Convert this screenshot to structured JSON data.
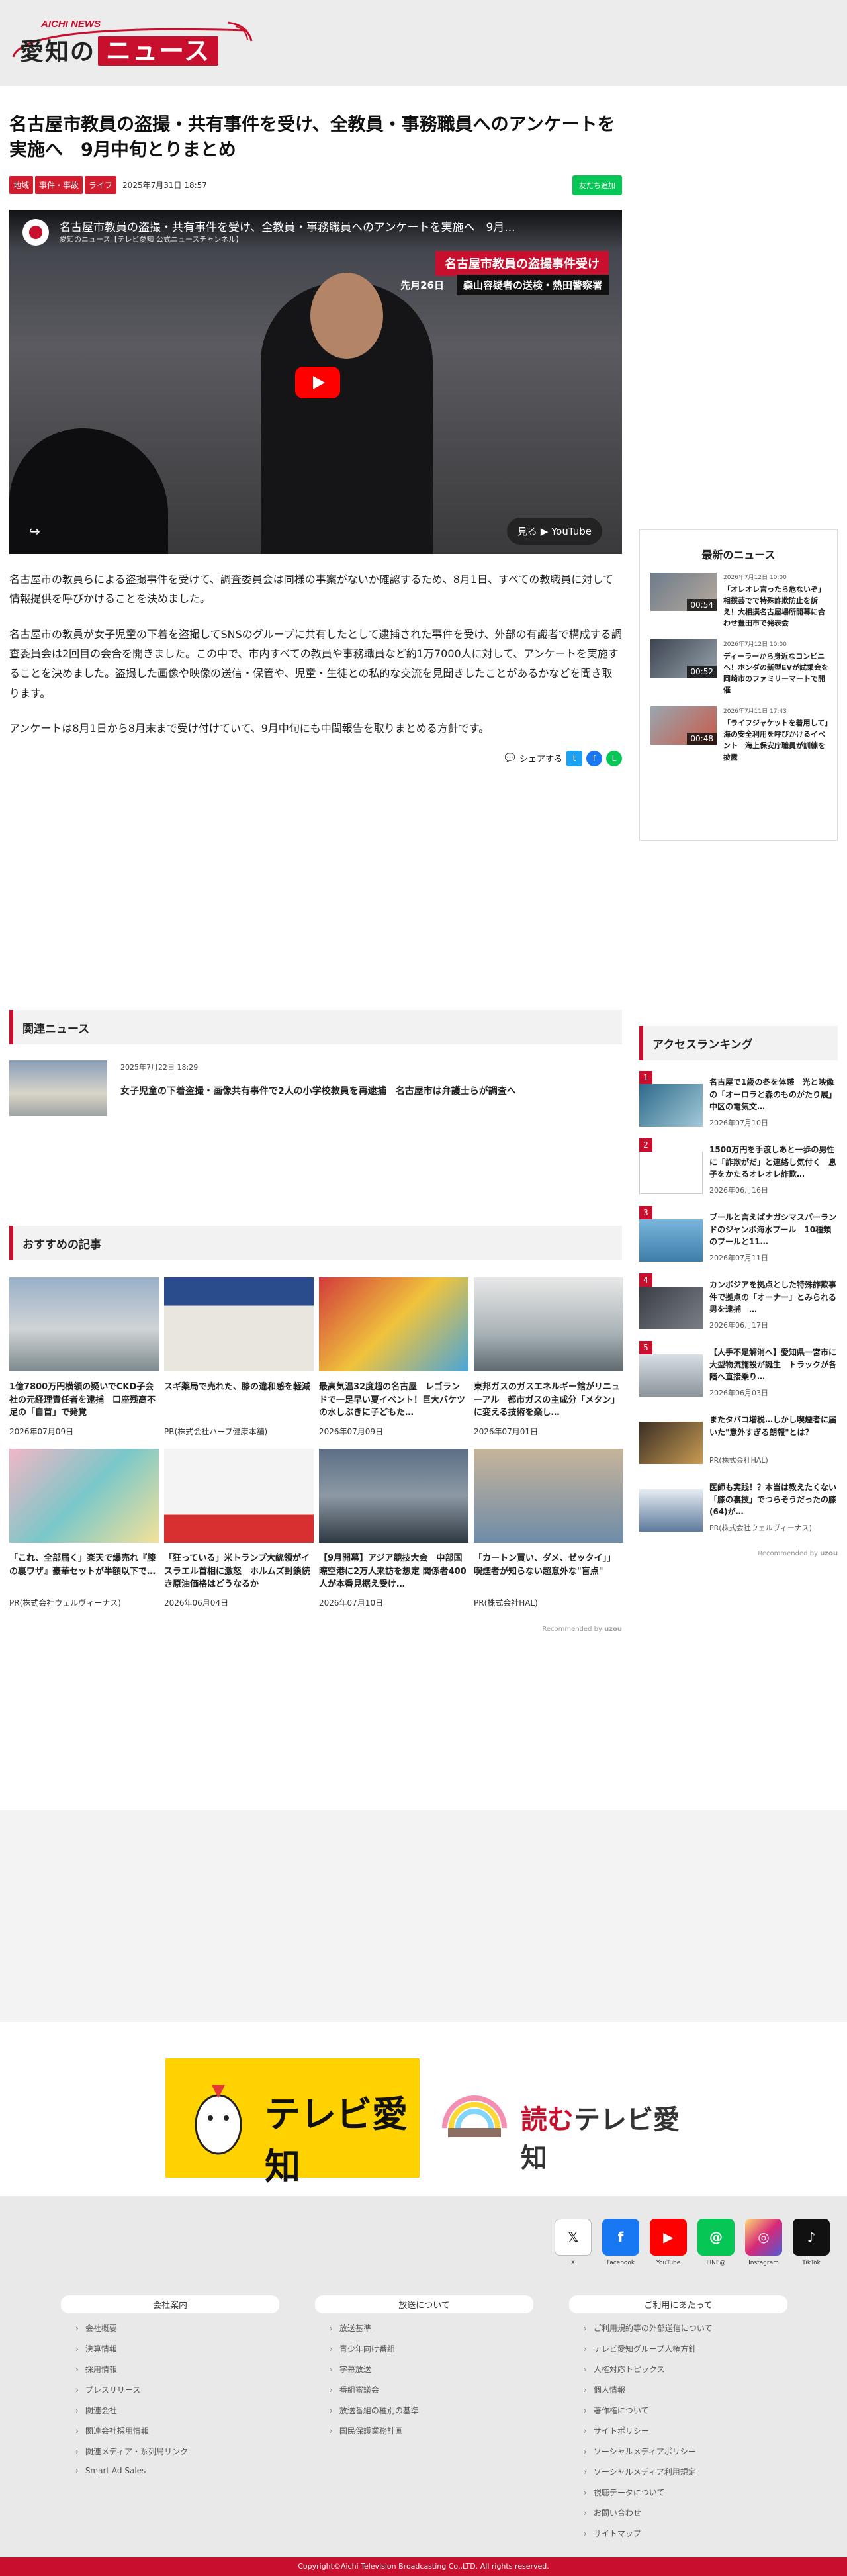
{
  "header": {
    "logo_en": "AICHI NEWS",
    "logo_jp_a": "愛知の",
    "logo_jp_b": "ニュース"
  },
  "article": {
    "title": "名古屋市教員の盗撮・共有事件を受け、全教員・事務職員へのアンケートを実施へ　9月中旬とりまとめ",
    "categories": [
      "地域",
      "事件・事故",
      "ライフ"
    ],
    "date": "2025年7月31日 18:57",
    "line_button": "友だち追加",
    "paragraphs": [
      "名古屋市の教員らによる盗撮事件を受けて、調査委員会は同様の事案がないか確認するため、8月1日、すべての教職員に対して情報提供を呼びかけることを決めました。",
      "名古屋市の教員が女子児童の下着を盗撮してSNSのグループに共有したとして逮捕された事件を受け、外部の有識者で構成する調査委員会は2回目の会合を開きました。この中で、市内すべての教員や事務職員など約1万7000人に対して、アンケートを実施することを決めました。盗撮した画像や映像の送信・保管や、児童・生徒との私的な交流を見聞きしたことがあるかなどを聞き取ります。",
      "アンケートは8月1日から8月末まで受け付けていて、9月中旬にも中間報告を取りまとめる方針です。"
    ],
    "share_label": "シェアする"
  },
  "video": {
    "title": "名古屋市教員の盗撮・共有事件を受け、全教員・事務職員へのアンケートを実施へ　9月...",
    "channel": "愛知のニュース【テレビ愛知 公式ニュースチャンネル】",
    "band": "名古屋市教員の盗撮事件受け",
    "day": "先月26日",
    "location": "森山容疑者の送検・熱田警察署",
    "watch": "見る ▶ YouTube"
  },
  "latest": {
    "title": "最新のニュース",
    "items": [
      {
        "date": "2026年7月12日 10:00",
        "title": "「オレオレ言ったら危ないぞ」相撲芸でで特殊詐欺防止を訴え！大相撲名古屋場所開幕に合わせ豊田市で発表会",
        "duration": "00:54"
      },
      {
        "date": "2026年7月12日 10:00",
        "title": "ディーラーから身近なコンビニへ！ホンダの新型EVが試乗会を岡崎市のファミリーマートで開催",
        "duration": "00:52"
      },
      {
        "date": "2026年7月11日 17:43",
        "title": "「ライフジャケットを着用して」　海の安全利用を呼びかけるイベント　海上保安庁職員が訓練を披露",
        "duration": "00:48"
      }
    ]
  },
  "related": {
    "title": "関連ニュース",
    "items": [
      {
        "date": "2025年7月22日 18:29",
        "title": "女子児童の下着盗撮・画像共有事件で2人の小学校教員を再逮捕　名古屋市は弁護士らが調査へ"
      }
    ]
  },
  "recommend": {
    "title": "おすすめの記事",
    "items": [
      {
        "title": "1億7800万円横領の疑いでCKD子会社の元経理責任者を逮捕　口座残高不足の「自首」で発覚",
        "sub": "2026年07月09日"
      },
      {
        "title": "スギ薬局で売れた、膝の違和感を軽減",
        "sub": "PR(株式会社ハーブ健康本舗)"
      },
      {
        "title": "最高気温32度超の名古屋　レゴランドで一足早い夏イベント！巨大バケツの水しぶきに子どもた…",
        "sub": "2026年07月09日"
      },
      {
        "title": "東邦ガスのガスエネルギー館がリニューアル　都市ガスの主成分「メタン」に変える技術を楽し…",
        "sub": "2026年07月01日"
      },
      {
        "title": "「これ、全部届く」楽天で爆売れ『膝の裏ワザ』豪華セットが半額以下で…",
        "sub": "PR(株式会社ウェルヴィーナス)"
      },
      {
        "title": "「狂っている」米トランプ大統領がイスラエル首相に激怒　ホルムズ封鎖続き原油価格はどうなるか",
        "sub": "2026年06月04日"
      },
      {
        "title": "【9月開幕】アジア競技大会　中部国際空港に2万人来訪を想定 関係者400人が本番見据え受け…",
        "sub": "2026年07月10日"
      },
      {
        "title": "「カートン買い、ダメ、ゼッタイ」」喫煙者が知らない超意外な\"盲点\"",
        "sub": "PR(株式会社HAL)"
      }
    ],
    "by": "Recommended by",
    "by_brand": "uzou"
  },
  "ranking": {
    "title": "アクセスランキング",
    "items": [
      {
        "num": "1",
        "title": "名古屋で1歳の冬を体感　光と映像の「オーロラと森のものがたり展」中区の電気文…",
        "date": "2026年07月10日"
      },
      {
        "num": "2",
        "title": "1500万円を手渡しあと一歩の男性に「詐欺がだ」と連絡し気付く　息子をかたるオレオレ詐欺…",
        "date": "2026年06月16日"
      },
      {
        "num": "3",
        "title": "プールと言えばナガシマスパーランドのジャンボ海水プール　10種類のプールと11…",
        "date": "2026年07月11日"
      },
      {
        "num": "4",
        "title": "カンボジアを拠点とした特殊詐欺事件で拠点の「オーナー」とみられる男を逮捕　…",
        "date": "2026年06月17日"
      },
      {
        "num": "5",
        "title": "【人手不足解消へ】愛知県一宮市に大型物流施設が誕生　トラックが各階へ直接乗り…",
        "date": "2026年06月03日"
      },
      {
        "num": "",
        "title": "またタバコ増税…しかし喫煙者に届いた\"意外すぎる朗報\"とは？",
        "date": "PR(株式会社HAL)"
      },
      {
        "num": "",
        "title": "医師も実践！？本当は教えたくない「膝の裏技」でつらそうだったの膝(64)が…",
        "date": "PR(株式会社ウェルヴィーナス)"
      }
    ],
    "by": "Recommended by",
    "by_brand": "uzou"
  },
  "banners": {
    "tv": "テレビ愛知",
    "yomu_a": "読む",
    "yomu_b": "テレビ愛知"
  },
  "footer": {
    "social": [
      {
        "label": "X",
        "glyph": "𝕏"
      },
      {
        "label": "Facebook",
        "glyph": "f"
      },
      {
        "label": "YouTube",
        "glyph": "▶"
      },
      {
        "label": "LINE@",
        "glyph": "@"
      },
      {
        "label": "Instagram",
        "glyph": "◎"
      },
      {
        "label": "TikTok",
        "glyph": "♪"
      }
    ],
    "col1": {
      "title": "会社案内",
      "links": [
        "会社概要",
        "決算情報",
        "採用情報",
        "プレスリリース",
        "関連会社",
        "関連会社採用情報",
        "関連メディア・系列局リンク",
        "Smart Ad Sales"
      ]
    },
    "col2": {
      "title": "放送について",
      "links": [
        "放送基準",
        "青少年向け番組",
        "字幕放送",
        "番組審議会",
        "放送番組の種別の基準",
        "国民保護業務計画"
      ]
    },
    "col3": {
      "title": "ご利用にあたって",
      "links": [
        "ご利用規約等の外部送信について",
        "テレビ愛知グループ人権方針",
        "人権対応トピックス",
        "個人情報",
        "著作権について",
        "サイトポリシー",
        "ソーシャルメディアポリシー",
        "ソーシャルメディア利用規定",
        "視聴データについて",
        "お問い合わせ",
        "サイトマップ"
      ]
    },
    "copyright": "Copyright©Aichi Television Broadcasting Co.,LTD. All rights reserved."
  },
  "colors": {
    "accent": "#c8102e",
    "line": "#06c755",
    "twitter": "#1da1f2",
    "facebook": "#1877f2"
  }
}
